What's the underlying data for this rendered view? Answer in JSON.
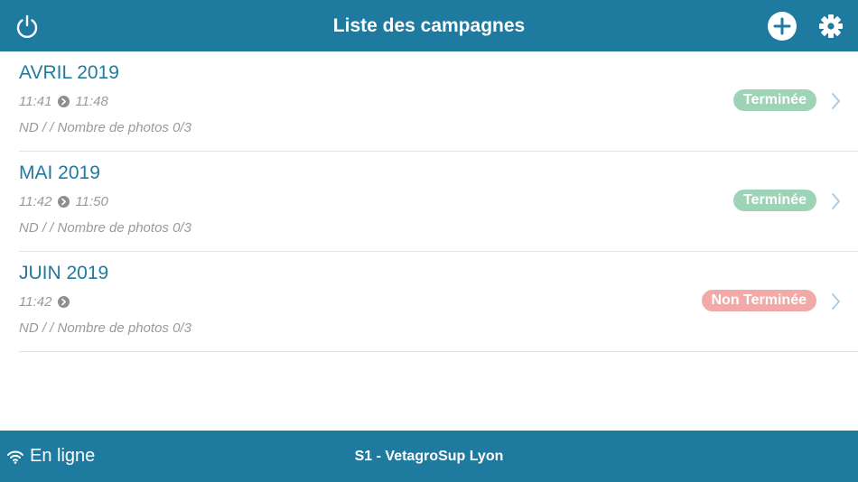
{
  "header": {
    "title": "Liste des campagnes",
    "power_icon": "power-icon",
    "add_icon": "plus-circle-icon",
    "settings_icon": "gear-icon"
  },
  "campaigns": [
    {
      "name": "AVRIL 2019",
      "start": "11:41",
      "end": "11:48",
      "info": "ND / / Nombre de photos 0/3",
      "status": "Terminée",
      "status_color": "#9dd4b6"
    },
    {
      "name": "MAI 2019",
      "start": "11:42",
      "end": "11:50",
      "info": "ND / / Nombre de photos 0/3",
      "status": "Terminée",
      "status_color": "#9dd4b6"
    },
    {
      "name": "JUIN 2019",
      "start": "11:42",
      "end": "",
      "info": "ND / / Nombre de photos 0/3",
      "status": "Non Terminée",
      "status_color": "#f2aaa8"
    }
  ],
  "footer": {
    "status_text": "En ligne",
    "status_icon": "wifi-icon",
    "site": "S1 - VetagroSup Lyon"
  },
  "colors": {
    "bar": "#1f7aa0",
    "accent_text": "#1f7aa0",
    "chevron": "#a9d0e2"
  }
}
